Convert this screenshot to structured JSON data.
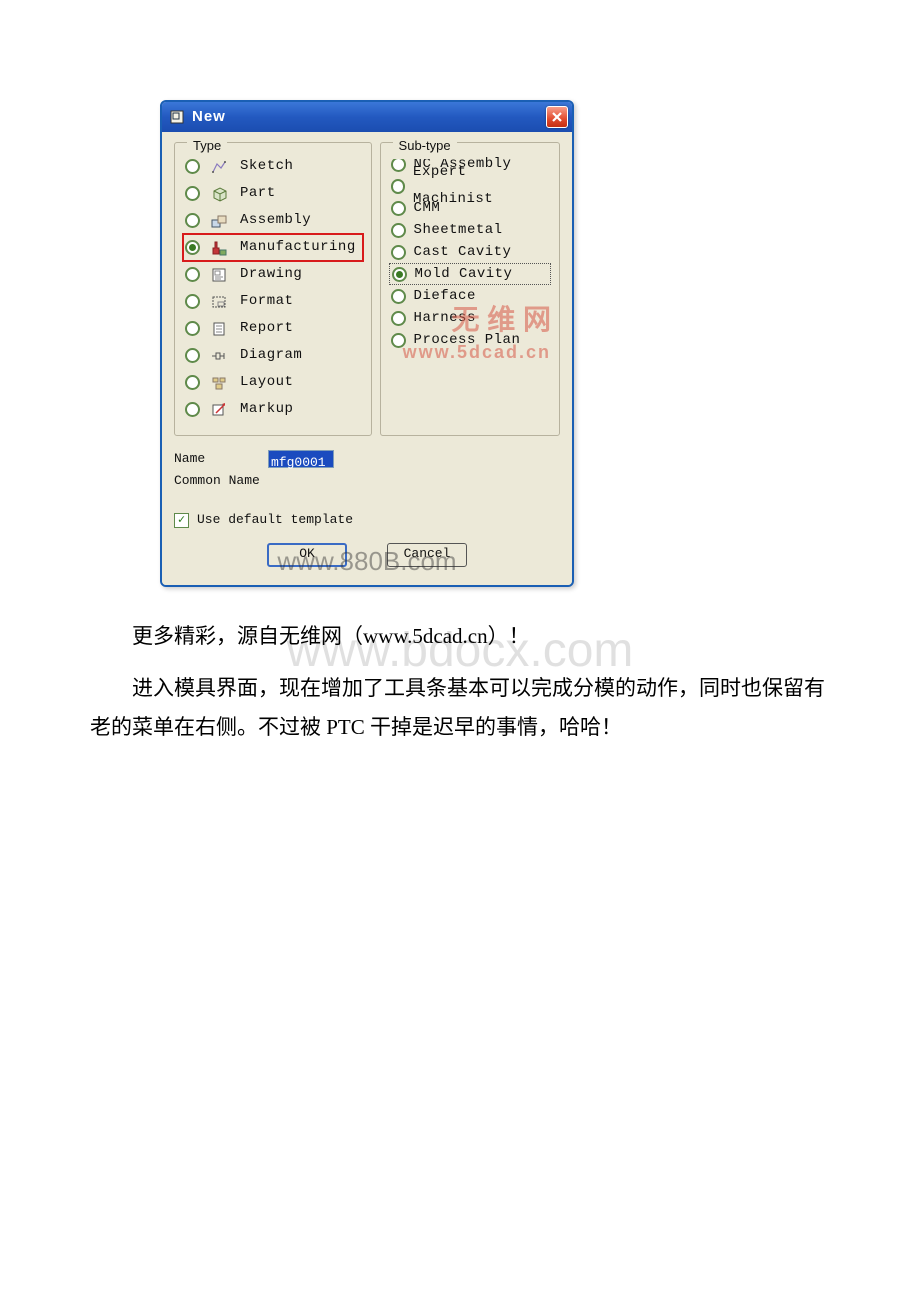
{
  "dialog": {
    "title": "New",
    "type_group_label": "Type",
    "subtype_group_label": "Sub-type",
    "types": [
      {
        "label": "Sketch",
        "icon": "sketch-icon",
        "selected": false
      },
      {
        "label": "Part",
        "icon": "part-icon",
        "selected": false
      },
      {
        "label": "Assembly",
        "icon": "assembly-icon",
        "selected": false
      },
      {
        "label": "Manufacturing",
        "icon": "manufacturing-icon",
        "selected": true
      },
      {
        "label": "Drawing",
        "icon": "drawing-icon",
        "selected": false
      },
      {
        "label": "Format",
        "icon": "format-icon",
        "selected": false
      },
      {
        "label": "Report",
        "icon": "report-icon",
        "selected": false
      },
      {
        "label": "Diagram",
        "icon": "diagram-icon",
        "selected": false
      },
      {
        "label": "Layout",
        "icon": "layout-icon",
        "selected": false
      },
      {
        "label": "Markup",
        "icon": "markup-icon",
        "selected": false
      }
    ],
    "subtypes": [
      {
        "label": "NC Assembly",
        "selected": false
      },
      {
        "label": "Expert Machinist",
        "selected": false
      },
      {
        "label": "CMM",
        "selected": false
      },
      {
        "label": "Sheetmetal",
        "selected": false
      },
      {
        "label": "Cast Cavity",
        "selected": false
      },
      {
        "label": "Mold Cavity",
        "selected": true
      },
      {
        "label": "Dieface",
        "selected": false
      },
      {
        "label": "Harness",
        "selected": false
      },
      {
        "label": "Process Plan",
        "selected": false
      }
    ],
    "name_label": "Name",
    "name_value": "mfg0001",
    "common_name_label": "Common Name",
    "common_name_value": "",
    "checkbox_label": "Use default template",
    "checkbox_checked": true,
    "ok_label": "OK",
    "cancel_label": "Cancel"
  },
  "watermarks": {
    "subtype_cn": "无 维 网",
    "subtype_url": "www.5dcad.cn",
    "button_overlay": "www.880B.com",
    "page_big": "www.bdocx.com"
  },
  "text": {
    "p1": "更多精彩，源自无维网（www.5dcad.cn）！",
    "p2": "进入模具界面，现在增加了工具条基本可以完成分模的动作，同时也保留有老的菜单在右侧。不过被 PTC 干掉是迟早的事情，哈哈！"
  }
}
